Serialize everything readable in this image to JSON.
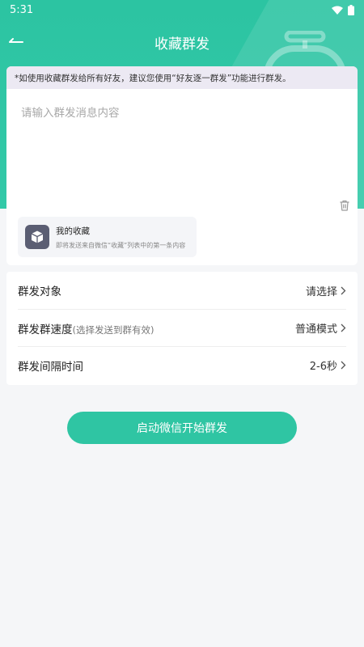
{
  "status_bar": {
    "time": "5:31"
  },
  "header": {
    "title": "收藏群发"
  },
  "notice": "*如使用收藏群发给所有好友，建议您使用“好友逐一群发”功能进行群发。",
  "message": {
    "placeholder": "请输入群发消息内容",
    "value": ""
  },
  "favorite": {
    "title": "我的收藏",
    "subtitle": "即将发送来自微信“收藏”列表中的第一条内容"
  },
  "settings": {
    "target": {
      "label": "群发对象",
      "value": "请选择"
    },
    "speed": {
      "label": "群发群速度",
      "hint": "(选择发送到群有效)",
      "value": "普通模式"
    },
    "interval": {
      "label": "群发间隔时间",
      "value": "2-6秒"
    }
  },
  "start_button": "启动微信开始群发",
  "colors": {
    "accent": "#2fc5a3",
    "notice_bg": "#ece9f3",
    "page_bg": "#f5f6f8"
  }
}
